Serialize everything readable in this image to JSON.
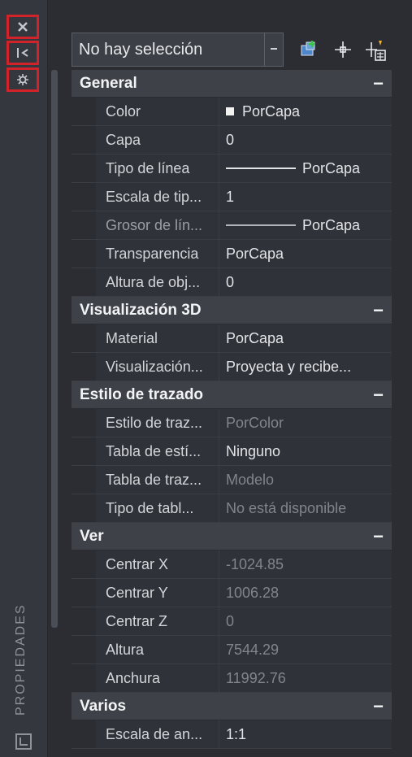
{
  "sidebar": {
    "vertical_label": "PROPIEDADES",
    "buttons": [
      "close-icon",
      "auto-hide-icon",
      "settings-icon"
    ]
  },
  "toolbar": {
    "selection": "No hay selección"
  },
  "sections": [
    {
      "title": "General",
      "collapse": "−",
      "rows": [
        {
          "label": "Color",
          "value": "PorCapa",
          "swatch": true
        },
        {
          "label": "Capa",
          "value": "0"
        },
        {
          "label": "Tipo de línea",
          "value": "PorCapa",
          "line": true
        },
        {
          "label": "Escala de tip...",
          "value": "1"
        },
        {
          "label": "Grosor de lín...",
          "value": "PorCapa",
          "line": true,
          "dim_label": true
        },
        {
          "label": "Transparencia",
          "value": "PorCapa"
        },
        {
          "label": "Altura de obj...",
          "value": "0"
        }
      ]
    },
    {
      "title": "Visualización 3D",
      "collapse": "−",
      "rows": [
        {
          "label": "Material",
          "value": "PorCapa"
        },
        {
          "label": "Visualización...",
          "value": "Proyecta y recibe..."
        }
      ]
    },
    {
      "title": "Estilo de trazado",
      "collapse": "−",
      "rows": [
        {
          "label": "Estilo de traz...",
          "value": "PorColor",
          "dim_value": true
        },
        {
          "label": "Tabla de estí...",
          "value": "Ninguno"
        },
        {
          "label": "Tabla de traz...",
          "value": "Modelo",
          "dim_value": true
        },
        {
          "label": "Tipo de tabl...",
          "value": "No está disponible",
          "dim_value": true
        }
      ]
    },
    {
      "title": "Ver",
      "collapse": "−",
      "rows": [
        {
          "label": "Centrar X",
          "value": "-1024.85",
          "dim_value": true
        },
        {
          "label": "Centrar Y",
          "value": "1006.28",
          "dim_value": true
        },
        {
          "label": "Centrar Z",
          "value": "0",
          "dim_value": true
        },
        {
          "label": "Altura",
          "value": "7544.29",
          "dim_value": true
        },
        {
          "label": "Anchura",
          "value": "11992.76",
          "dim_value": true
        }
      ]
    },
    {
      "title": "Varios",
      "collapse": "−",
      "rows": [
        {
          "label": "Escala de an...",
          "value": "1:1"
        }
      ]
    }
  ]
}
